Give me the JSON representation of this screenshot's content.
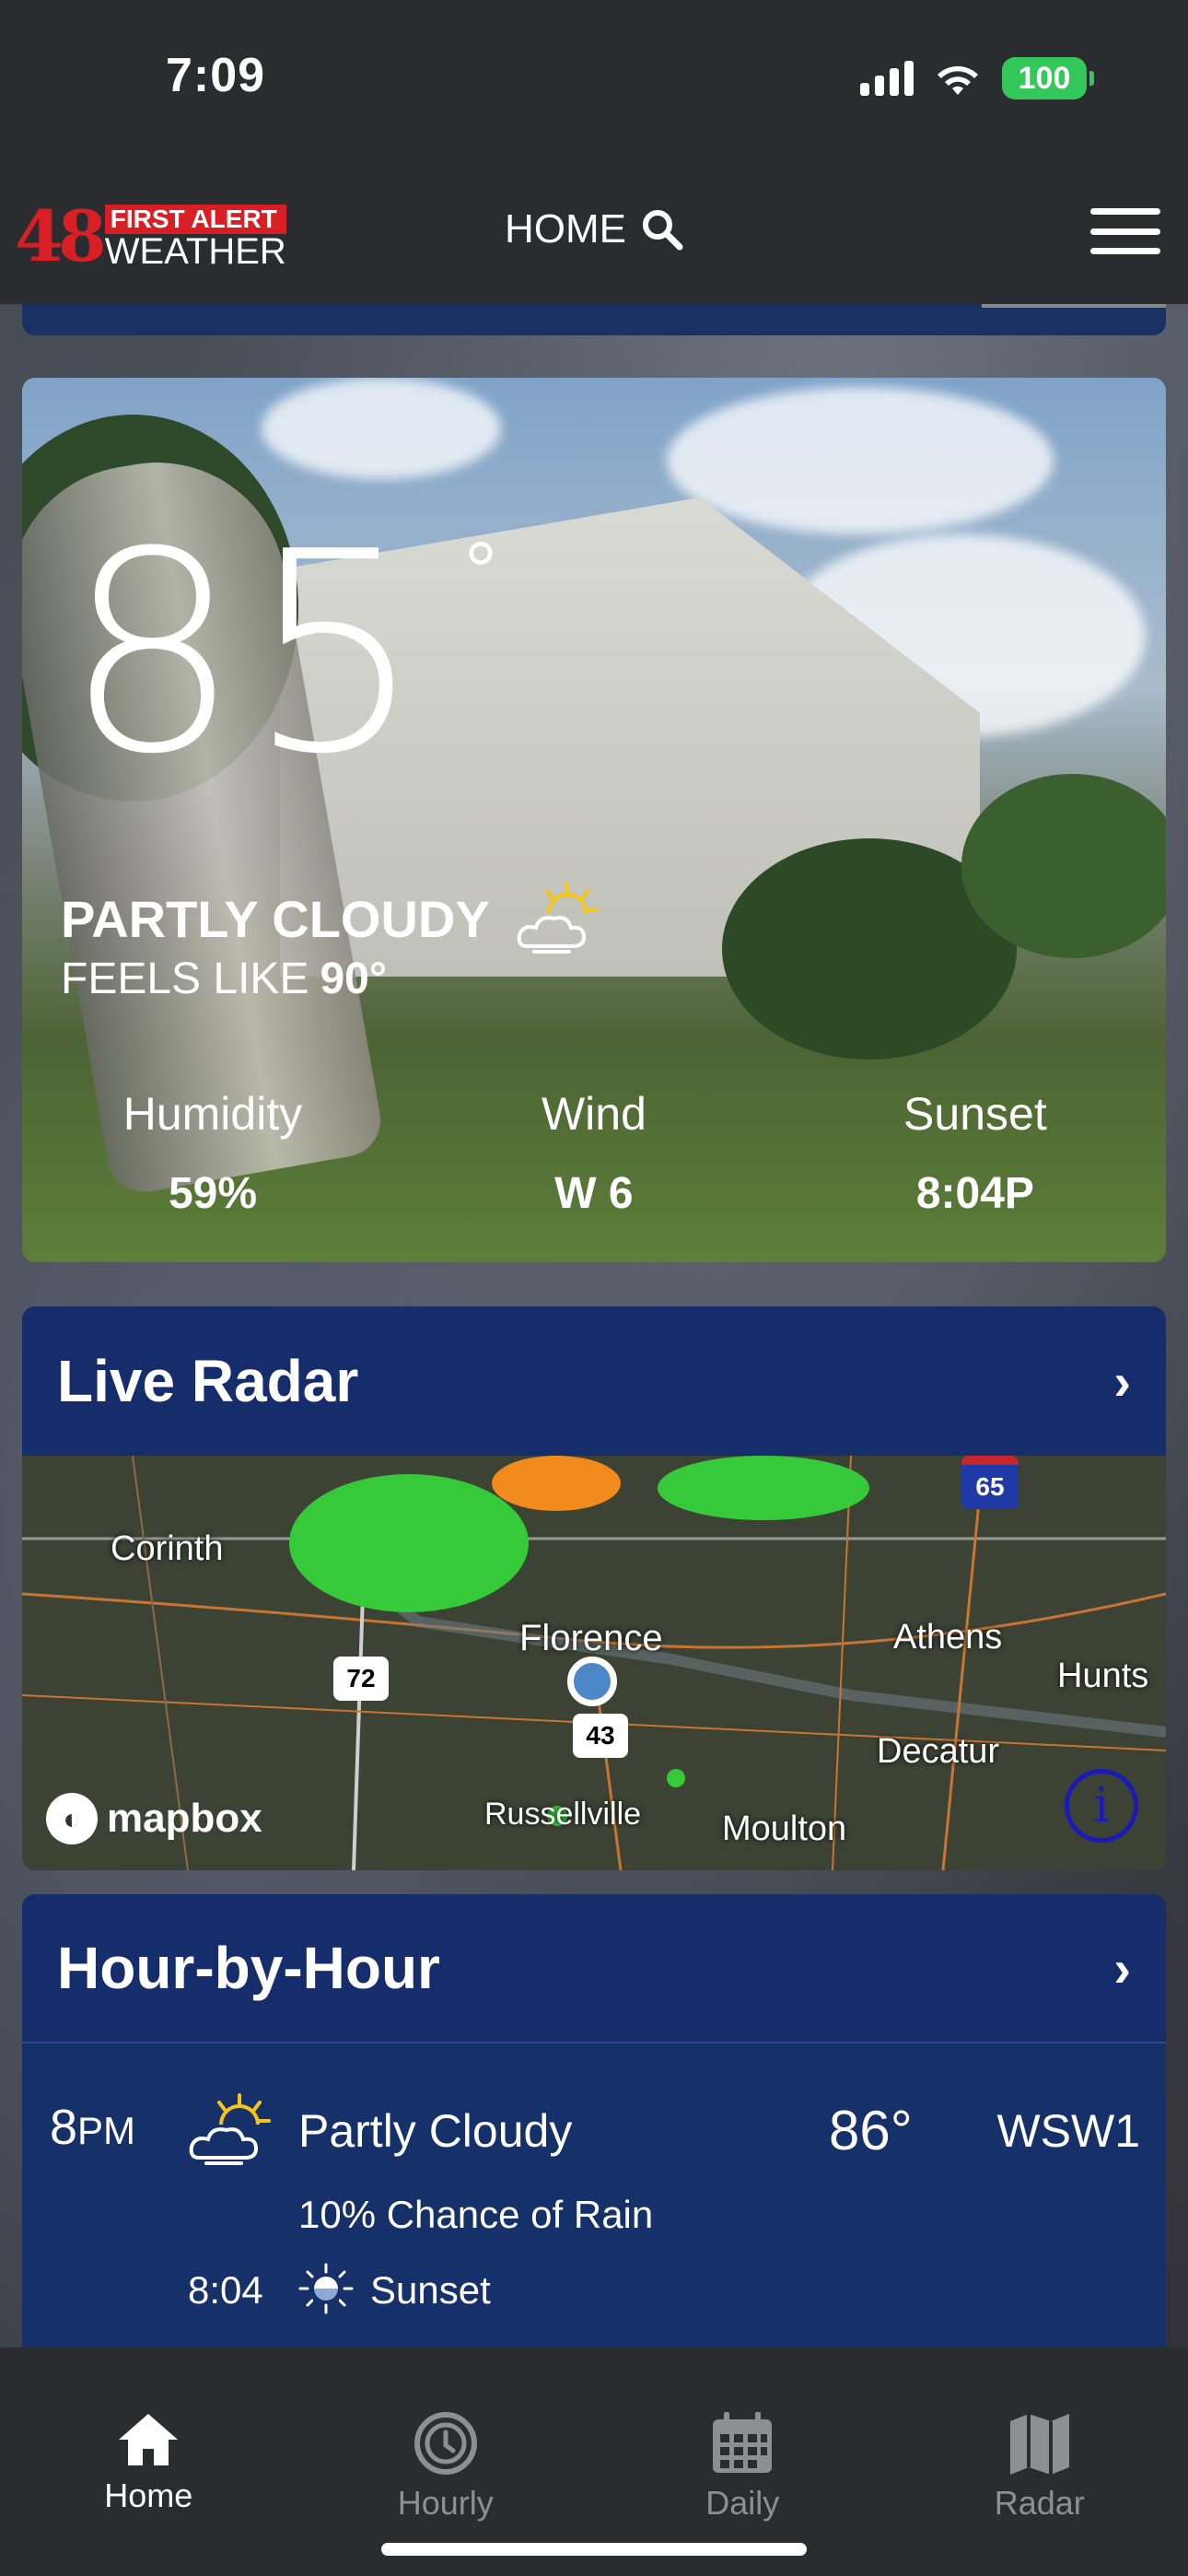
{
  "status_bar": {
    "time": "7:09",
    "battery": "100"
  },
  "header": {
    "logo_number": "48",
    "logo_line1": "FIRST ALERT",
    "logo_line2": "WEATHER",
    "title": "HOME"
  },
  "current": {
    "temperature": "85",
    "degree_symbol": "°",
    "condition": "PARTLY CLOUDY",
    "feels_like_label": "FEELS LIKE",
    "feels_like_value": "90°",
    "stats": [
      {
        "label": "Humidity",
        "value": "59%"
      },
      {
        "label": "Wind",
        "value": "W 6"
      },
      {
        "label": "Sunset",
        "value": "8:04P"
      }
    ]
  },
  "radar": {
    "title": "Live Radar",
    "chevron": "›",
    "places": [
      "Corinth",
      "Florence",
      "Athens",
      "Hunts",
      "Decatur",
      "Russellville",
      "Moulton"
    ],
    "shields": [
      "72",
      "43",
      "65"
    ],
    "attribution": "mapbox",
    "info": "i"
  },
  "hourly": {
    "title": "Hour-by-Hour",
    "chevron": "›",
    "rows": [
      {
        "hour": "8",
        "ampm": "PM",
        "condition": "Partly Cloudy",
        "temp": "86°",
        "wind": "WSW1",
        "rain": "10% Chance of Rain",
        "sunset_time": "8:04",
        "sunset_label": "Sunset"
      }
    ]
  },
  "tabs": [
    {
      "label": "Home",
      "icon": "home-icon",
      "active": true
    },
    {
      "label": "Hourly",
      "icon": "clock-icon",
      "active": false
    },
    {
      "label": "Daily",
      "icon": "calendar-icon",
      "active": false
    },
    {
      "label": "Radar",
      "icon": "map-icon",
      "active": false
    }
  ],
  "colors": {
    "brand_red": "#d91f26",
    "card_blue": "#152e6b",
    "battery_green": "#34c759",
    "inactive_tab": "#8e8f93"
  }
}
